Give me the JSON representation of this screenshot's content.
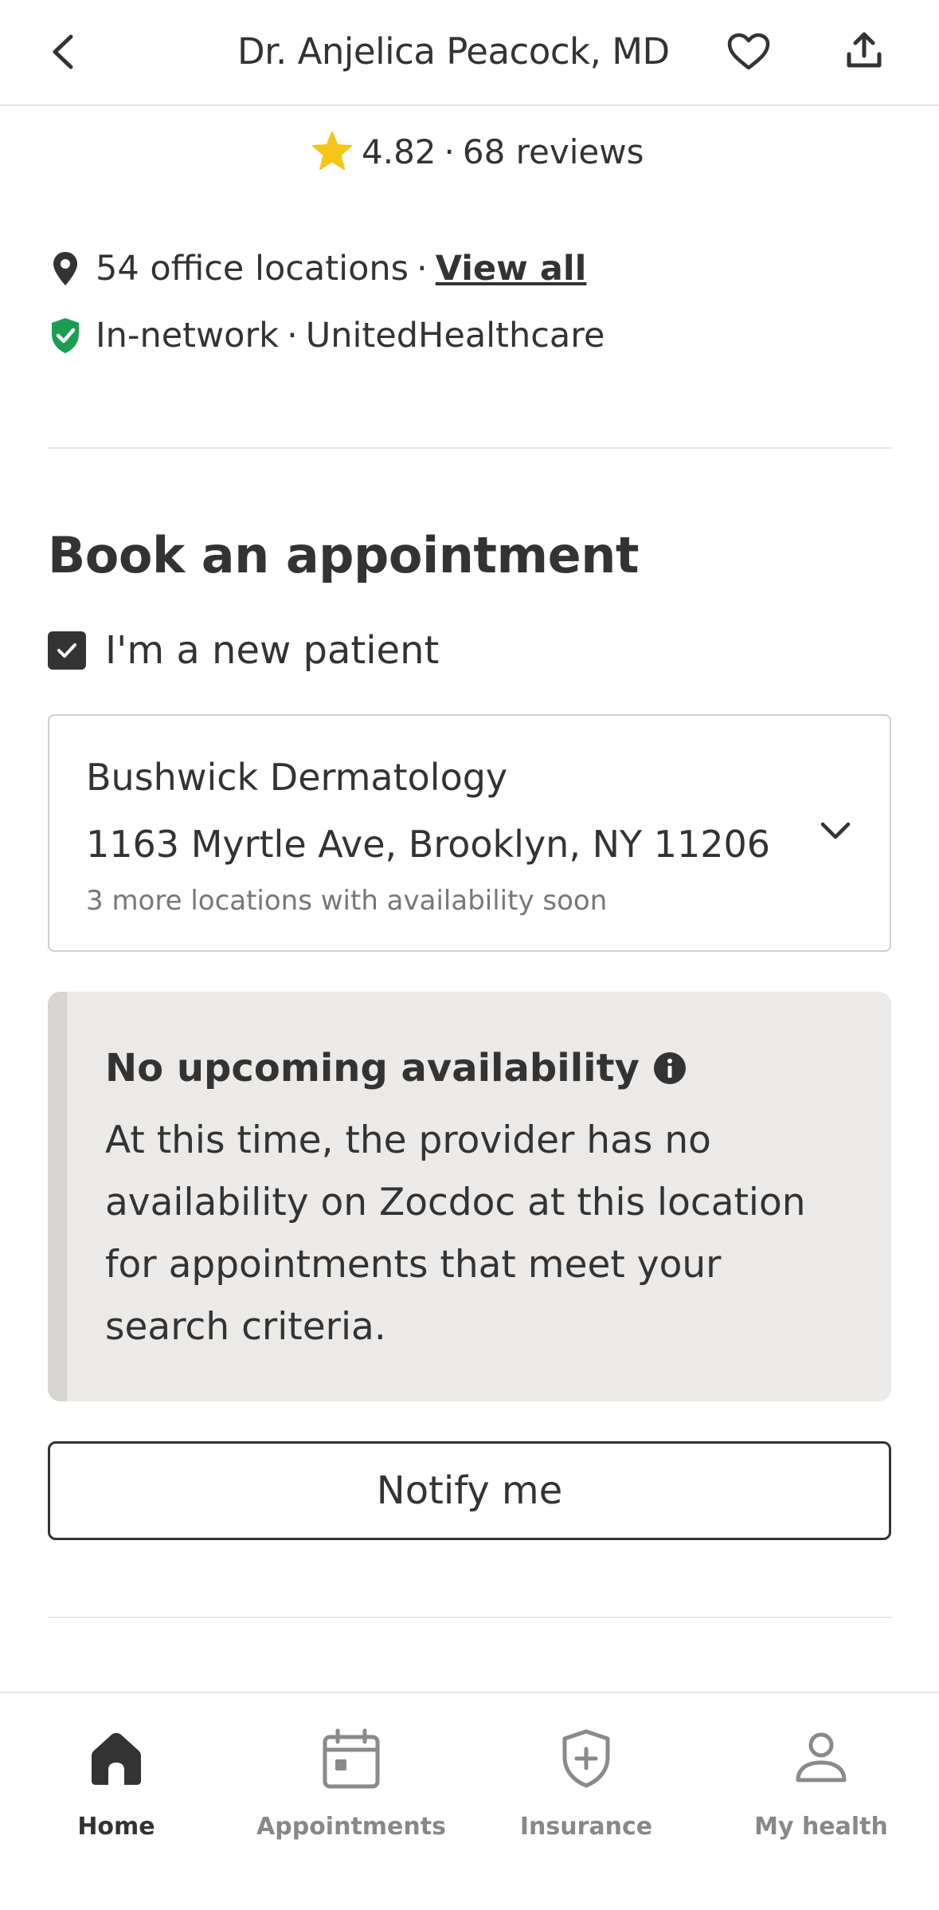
{
  "header": {
    "title": "Dr. Anjelica Peacock, MD",
    "back_icon": "chevron-left-icon",
    "favorite_icon": "heart-outline-icon",
    "share_icon": "share-upload-icon"
  },
  "rating": {
    "score": "4.82",
    "separator": "·",
    "reviews": "68 reviews",
    "star_color": "#f5c518"
  },
  "location_info": {
    "text": "54 office locations",
    "separator": "·",
    "link": "View all"
  },
  "network_info": {
    "status": "In-network",
    "separator": "·",
    "insurer": "UnitedHealthcare",
    "badge_color": "#1a9e54"
  },
  "booking": {
    "title": "Book an appointment",
    "new_patient_label": "I'm a new patient",
    "new_patient_checked": true,
    "location": {
      "name": "Bushwick Dermatology",
      "address": "1163 Myrtle Ave, Brooklyn, NY 11206",
      "more": "3 more locations with availability soon"
    },
    "notice": {
      "title": "No upcoming availability",
      "body": "At this time, the provider has no availability on Zocdoc at this location for appointments that meet your search criteria."
    },
    "notify_label": "Notify me"
  },
  "nav": {
    "items": [
      {
        "label": "Home",
        "icon": "home-icon",
        "active": true
      },
      {
        "label": "Appointments",
        "icon": "calendar-icon",
        "active": false
      },
      {
        "label": "Insurance",
        "icon": "shield-plus-icon",
        "active": false
      },
      {
        "label": "My health",
        "icon": "person-icon",
        "active": false
      }
    ]
  }
}
